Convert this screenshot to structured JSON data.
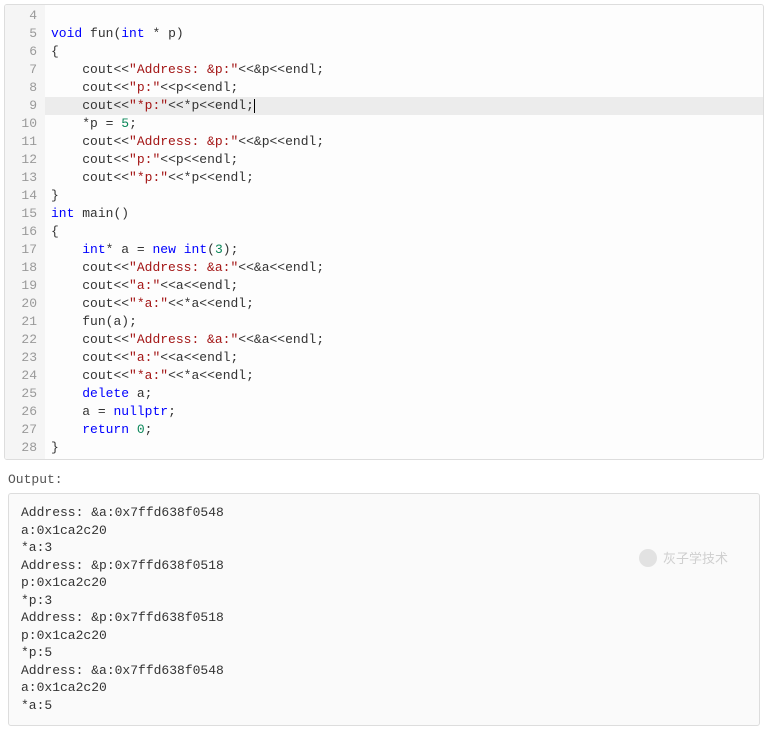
{
  "editor": {
    "highlighted_line": 9,
    "lines": [
      {
        "n": 4,
        "tokens": []
      },
      {
        "n": 5,
        "tokens": [
          {
            "t": "kw",
            "v": "void"
          },
          {
            "t": "sp",
            "v": " "
          },
          {
            "t": "ident",
            "v": "fun"
          },
          {
            "t": "punct",
            "v": "("
          },
          {
            "t": "type",
            "v": "int"
          },
          {
            "t": "sp",
            "v": " "
          },
          {
            "t": "op",
            "v": "* "
          },
          {
            "t": "ident",
            "v": "p"
          },
          {
            "t": "punct",
            "v": ")"
          }
        ]
      },
      {
        "n": 6,
        "tokens": [
          {
            "t": "punct",
            "v": "{"
          }
        ]
      },
      {
        "n": 7,
        "indent": 1,
        "tokens": [
          {
            "t": "ident",
            "v": "cout"
          },
          {
            "t": "op",
            "v": "<<"
          },
          {
            "t": "str",
            "v": "\"Address: &p:\""
          },
          {
            "t": "op",
            "v": "<<"
          },
          {
            "t": "op",
            "v": "&"
          },
          {
            "t": "ident",
            "v": "p"
          },
          {
            "t": "op",
            "v": "<<"
          },
          {
            "t": "ident",
            "v": "endl"
          },
          {
            "t": "punct",
            "v": ";"
          }
        ]
      },
      {
        "n": 8,
        "indent": 1,
        "tokens": [
          {
            "t": "ident",
            "v": "cout"
          },
          {
            "t": "op",
            "v": "<<"
          },
          {
            "t": "str",
            "v": "\"p:\""
          },
          {
            "t": "op",
            "v": "<<"
          },
          {
            "t": "ident",
            "v": "p"
          },
          {
            "t": "op",
            "v": "<<"
          },
          {
            "t": "ident",
            "v": "endl"
          },
          {
            "t": "punct",
            "v": ";"
          }
        ]
      },
      {
        "n": 9,
        "indent": 1,
        "tokens": [
          {
            "t": "ident",
            "v": "cout"
          },
          {
            "t": "op",
            "v": "<<"
          },
          {
            "t": "str",
            "v": "\"*p:\""
          },
          {
            "t": "op",
            "v": "<<"
          },
          {
            "t": "op",
            "v": "*"
          },
          {
            "t": "ident",
            "v": "p"
          },
          {
            "t": "op",
            "v": "<<"
          },
          {
            "t": "ident",
            "v": "endl"
          },
          {
            "t": "punct",
            "v": ";"
          },
          {
            "t": "cursor",
            "v": ""
          }
        ]
      },
      {
        "n": 10,
        "indent": 1,
        "tokens": [
          {
            "t": "op",
            "v": "*"
          },
          {
            "t": "ident",
            "v": "p"
          },
          {
            "t": "sp",
            "v": " "
          },
          {
            "t": "op",
            "v": "="
          },
          {
            "t": "sp",
            "v": " "
          },
          {
            "t": "num",
            "v": "5"
          },
          {
            "t": "punct",
            "v": ";"
          }
        ]
      },
      {
        "n": 11,
        "indent": 1,
        "tokens": [
          {
            "t": "ident",
            "v": "cout"
          },
          {
            "t": "op",
            "v": "<<"
          },
          {
            "t": "str",
            "v": "\"Address: &p:\""
          },
          {
            "t": "op",
            "v": "<<"
          },
          {
            "t": "op",
            "v": "&"
          },
          {
            "t": "ident",
            "v": "p"
          },
          {
            "t": "op",
            "v": "<<"
          },
          {
            "t": "ident",
            "v": "endl"
          },
          {
            "t": "punct",
            "v": ";"
          }
        ]
      },
      {
        "n": 12,
        "indent": 1,
        "tokens": [
          {
            "t": "ident",
            "v": "cout"
          },
          {
            "t": "op",
            "v": "<<"
          },
          {
            "t": "str",
            "v": "\"p:\""
          },
          {
            "t": "op",
            "v": "<<"
          },
          {
            "t": "ident",
            "v": "p"
          },
          {
            "t": "op",
            "v": "<<"
          },
          {
            "t": "ident",
            "v": "endl"
          },
          {
            "t": "punct",
            "v": ";"
          }
        ]
      },
      {
        "n": 13,
        "indent": 1,
        "tokens": [
          {
            "t": "ident",
            "v": "cout"
          },
          {
            "t": "op",
            "v": "<<"
          },
          {
            "t": "str",
            "v": "\"*p:\""
          },
          {
            "t": "op",
            "v": "<<"
          },
          {
            "t": "op",
            "v": "*"
          },
          {
            "t": "ident",
            "v": "p"
          },
          {
            "t": "op",
            "v": "<<"
          },
          {
            "t": "ident",
            "v": "endl"
          },
          {
            "t": "punct",
            "v": ";"
          }
        ]
      },
      {
        "n": 14,
        "tokens": [
          {
            "t": "punct",
            "v": "}"
          }
        ]
      },
      {
        "n": 15,
        "tokens": [
          {
            "t": "type",
            "v": "int"
          },
          {
            "t": "sp",
            "v": " "
          },
          {
            "t": "ident",
            "v": "main"
          },
          {
            "t": "punct",
            "v": "()"
          }
        ]
      },
      {
        "n": 16,
        "tokens": [
          {
            "t": "punct",
            "v": "{"
          }
        ]
      },
      {
        "n": 17,
        "indent": 1,
        "tokens": [
          {
            "t": "type",
            "v": "int"
          },
          {
            "t": "op",
            "v": "*"
          },
          {
            "t": "sp",
            "v": " "
          },
          {
            "t": "ident",
            "v": "a"
          },
          {
            "t": "sp",
            "v": " "
          },
          {
            "t": "op",
            "v": "="
          },
          {
            "t": "sp",
            "v": " "
          },
          {
            "t": "kw",
            "v": "new"
          },
          {
            "t": "sp",
            "v": " "
          },
          {
            "t": "type",
            "v": "int"
          },
          {
            "t": "punct",
            "v": "("
          },
          {
            "t": "num",
            "v": "3"
          },
          {
            "t": "punct",
            "v": ")"
          },
          {
            "t": "punct",
            "v": ";"
          }
        ]
      },
      {
        "n": 18,
        "indent": 1,
        "tokens": [
          {
            "t": "ident",
            "v": "cout"
          },
          {
            "t": "op",
            "v": "<<"
          },
          {
            "t": "str",
            "v": "\"Address: &a:\""
          },
          {
            "t": "op",
            "v": "<<"
          },
          {
            "t": "op",
            "v": "&"
          },
          {
            "t": "ident",
            "v": "a"
          },
          {
            "t": "op",
            "v": "<<"
          },
          {
            "t": "ident",
            "v": "endl"
          },
          {
            "t": "punct",
            "v": ";"
          }
        ]
      },
      {
        "n": 19,
        "indent": 1,
        "tokens": [
          {
            "t": "ident",
            "v": "cout"
          },
          {
            "t": "op",
            "v": "<<"
          },
          {
            "t": "str",
            "v": "\"a:\""
          },
          {
            "t": "op",
            "v": "<<"
          },
          {
            "t": "ident",
            "v": "a"
          },
          {
            "t": "op",
            "v": "<<"
          },
          {
            "t": "ident",
            "v": "endl"
          },
          {
            "t": "punct",
            "v": ";"
          }
        ]
      },
      {
        "n": 20,
        "indent": 1,
        "tokens": [
          {
            "t": "ident",
            "v": "cout"
          },
          {
            "t": "op",
            "v": "<<"
          },
          {
            "t": "str",
            "v": "\"*a:\""
          },
          {
            "t": "op",
            "v": "<<"
          },
          {
            "t": "op",
            "v": "*"
          },
          {
            "t": "ident",
            "v": "a"
          },
          {
            "t": "op",
            "v": "<<"
          },
          {
            "t": "ident",
            "v": "endl"
          },
          {
            "t": "punct",
            "v": ";"
          }
        ]
      },
      {
        "n": 21,
        "indent": 1,
        "tokens": [
          {
            "t": "ident",
            "v": "fun"
          },
          {
            "t": "punct",
            "v": "("
          },
          {
            "t": "ident",
            "v": "a"
          },
          {
            "t": "punct",
            "v": ")"
          },
          {
            "t": "punct",
            "v": ";"
          }
        ]
      },
      {
        "n": 22,
        "indent": 1,
        "tokens": [
          {
            "t": "ident",
            "v": "cout"
          },
          {
            "t": "op",
            "v": "<<"
          },
          {
            "t": "str",
            "v": "\"Address: &a:\""
          },
          {
            "t": "op",
            "v": "<<"
          },
          {
            "t": "op",
            "v": "&"
          },
          {
            "t": "ident",
            "v": "a"
          },
          {
            "t": "op",
            "v": "<<"
          },
          {
            "t": "ident",
            "v": "endl"
          },
          {
            "t": "punct",
            "v": ";"
          }
        ]
      },
      {
        "n": 23,
        "indent": 1,
        "tokens": [
          {
            "t": "ident",
            "v": "cout"
          },
          {
            "t": "op",
            "v": "<<"
          },
          {
            "t": "str",
            "v": "\"a:\""
          },
          {
            "t": "op",
            "v": "<<"
          },
          {
            "t": "ident",
            "v": "a"
          },
          {
            "t": "op",
            "v": "<<"
          },
          {
            "t": "ident",
            "v": "endl"
          },
          {
            "t": "punct",
            "v": ";"
          }
        ]
      },
      {
        "n": 24,
        "indent": 1,
        "tokens": [
          {
            "t": "ident",
            "v": "cout"
          },
          {
            "t": "op",
            "v": "<<"
          },
          {
            "t": "str",
            "v": "\"*a:\""
          },
          {
            "t": "op",
            "v": "<<"
          },
          {
            "t": "op",
            "v": "*"
          },
          {
            "t": "ident",
            "v": "a"
          },
          {
            "t": "op",
            "v": "<<"
          },
          {
            "t": "ident",
            "v": "endl"
          },
          {
            "t": "punct",
            "v": ";"
          }
        ]
      },
      {
        "n": 25,
        "indent": 1,
        "tokens": [
          {
            "t": "kw",
            "v": "delete"
          },
          {
            "t": "sp",
            "v": " "
          },
          {
            "t": "ident",
            "v": "a"
          },
          {
            "t": "punct",
            "v": ";"
          }
        ]
      },
      {
        "n": 26,
        "indent": 1,
        "tokens": [
          {
            "t": "ident",
            "v": "a"
          },
          {
            "t": "sp",
            "v": " "
          },
          {
            "t": "op",
            "v": "="
          },
          {
            "t": "sp",
            "v": " "
          },
          {
            "t": "kw",
            "v": "nullptr"
          },
          {
            "t": "punct",
            "v": ";"
          }
        ]
      },
      {
        "n": 27,
        "indent": 1,
        "tokens": [
          {
            "t": "kw",
            "v": "return"
          },
          {
            "t": "sp",
            "v": " "
          },
          {
            "t": "num",
            "v": "0"
          },
          {
            "t": "punct",
            "v": ";"
          }
        ]
      },
      {
        "n": 28,
        "tokens": [
          {
            "t": "punct",
            "v": "}"
          }
        ]
      }
    ]
  },
  "output_label": "Output:",
  "output_lines": [
    "Address: &a:0x7ffd638f0548",
    "a:0x1ca2c20",
    "*a:3",
    "Address: &p:0x7ffd638f0518",
    "p:0x1ca2c20",
    "*p:3",
    "Address: &p:0x7ffd638f0518",
    "p:0x1ca2c20",
    "*p:5",
    "Address: &a:0x7ffd638f0548",
    "a:0x1ca2c20",
    "*a:5"
  ],
  "watermark": "灰子学技术"
}
